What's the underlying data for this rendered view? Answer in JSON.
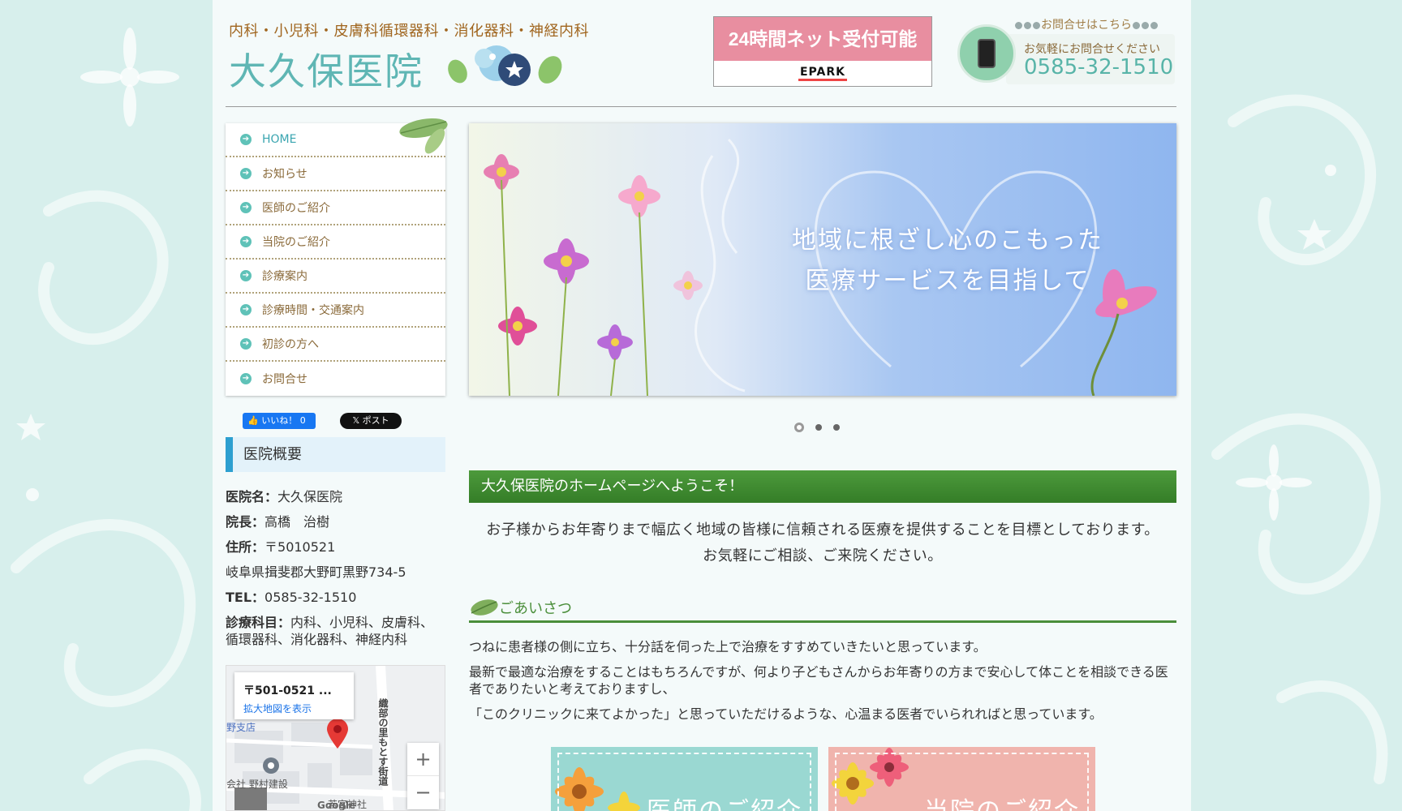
{
  "header": {
    "subtitle": "内科・小児科・皮膚科循環器科・消化器科・神経内科",
    "logo": "大久保医院",
    "epark_banner": "24時間ネット受付可能",
    "epark_logo": "EPARK",
    "contact_heading": "お問合せはこちら",
    "contact_sub": "お気軽にお問合せください",
    "contact_tel": "0585-32-1510"
  },
  "nav": {
    "items": [
      {
        "label": "HOME"
      },
      {
        "label": "お知らせ"
      },
      {
        "label": "医師のご紹介"
      },
      {
        "label": "当院のご紹介"
      },
      {
        "label": "診療案内"
      },
      {
        "label": "診療時間・交通案内"
      },
      {
        "label": "初診の方へ"
      },
      {
        "label": "お問合せ"
      }
    ]
  },
  "social": {
    "facebook_label": "いいね！ 0",
    "x_label": "ポスト"
  },
  "overview": {
    "heading": "医院概要",
    "name_label": "医院名：",
    "name_value": "大久保医院",
    "director_label": "院長：",
    "director_value": "高橋　治樹",
    "address_label": "住所：",
    "postal": "〒5010521",
    "address": "岐阜県揖斐郡大野町黒野734-5",
    "tel_label": "TEL：",
    "tel_value": "0585-32-1510",
    "departments_label": "診療科目：",
    "departments_value": "内科、小児科、皮膚科、循環器科、消化器科、神経内科"
  },
  "map": {
    "address": "〒501-0521 ...",
    "link": "拡大地図を表示",
    "zoom_in": "+",
    "zoom_out": "−",
    "labels": {
      "branch": "野支店",
      "road": "織部の里もとす街道",
      "construction": "会社 野村建設",
      "shrine": "若宮神社",
      "google": "Google"
    }
  },
  "hero": {
    "line1": "地域に根ざし心のこもった",
    "line2": "医療サービスを目指して"
  },
  "welcome": {
    "bar": "大久保医院のホームページへようこそ！",
    "line1": "お子様からお年寄りまで幅広く地域の皆様に信頼される医療を提供することを目標としております。",
    "line2": "お気軽にご相談、ご来院ください。"
  },
  "greeting": {
    "title": "ごあいさつ",
    "p1": "つねに患者様の側に立ち、十分話を伺った上で治療をすすめていきたいと思っています。",
    "p2": "最新で最適な治療をすることはもちろんですが、何より子どもさんからお年寄りの方まで安心して体ことを相談できる医者でありたいと考えておりますし、",
    "p3": "「このクリニックに来てよかった」と思っていただけるような、心温まる医者でいられればと思っています。"
  },
  "banners": {
    "doctor": "医師のご紹介",
    "clinic": "当院のご紹介"
  },
  "colors": {
    "accent_teal": "#5fb6b4",
    "welcome_green": "#3f8a30",
    "overview_blue": "#2d9fd0",
    "banner_teal": "#9ad8d2",
    "banner_pink": "#f0b4ad"
  }
}
